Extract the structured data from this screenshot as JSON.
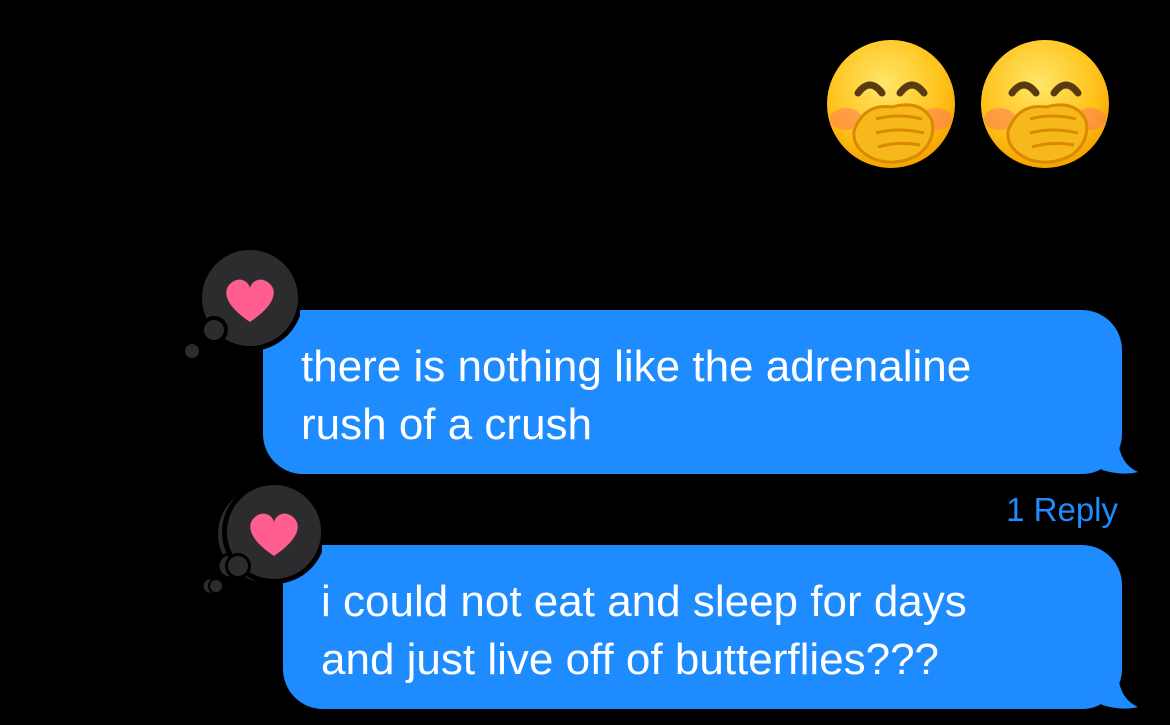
{
  "colors": {
    "background": "#000000",
    "bubble_blue": "#1e8bff",
    "reaction_bubble": "#2c2c2e",
    "heart": "#ff5e8e",
    "reply_link": "#1e8bff"
  },
  "header_emojis": [
    {
      "icon": "face-with-hand-over-mouth-icon"
    },
    {
      "icon": "face-with-hand-over-mouth-icon"
    }
  ],
  "messages": [
    {
      "text": "there is nothing like the adrenaline\nrush of a crush",
      "reaction": "heart-icon"
    },
    {
      "text": "i could not eat and sleep for days\nand just live off of butterflies???",
      "reaction": "heart-icon"
    }
  ],
  "reply_count_label": "1 Reply"
}
